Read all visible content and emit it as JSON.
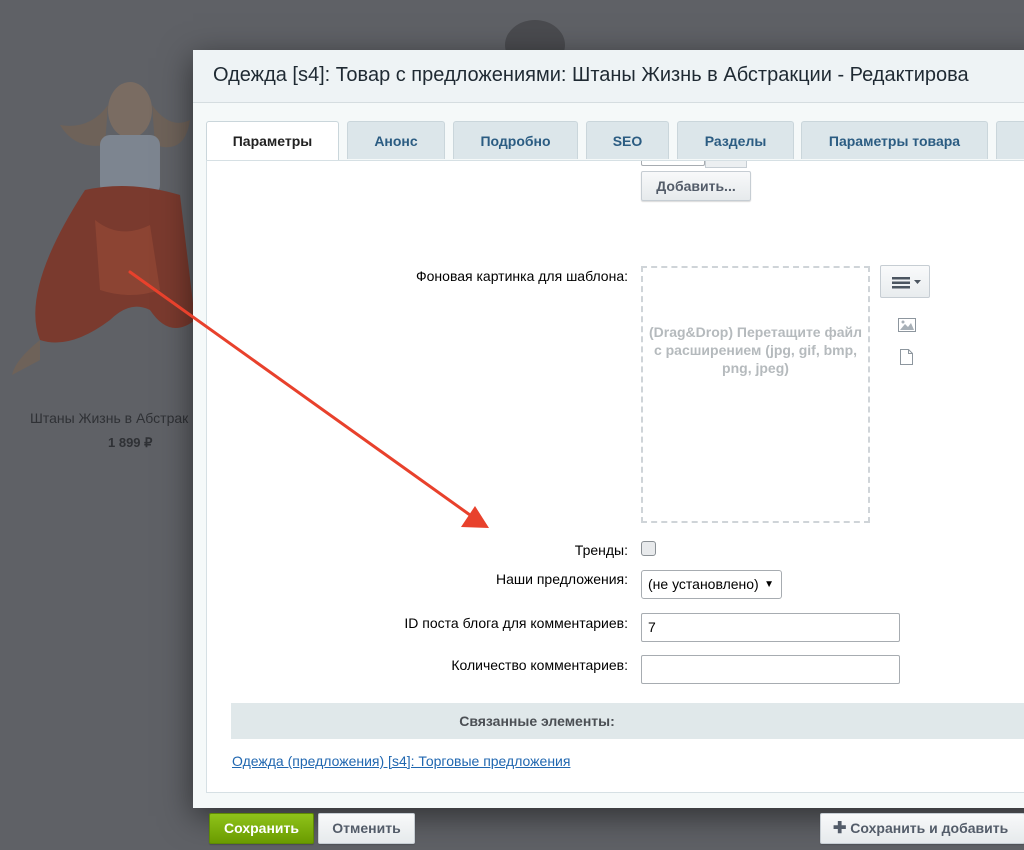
{
  "background": {
    "product_title": "Штаны Жизнь в Абстрак",
    "product_price": "1 899 ₽"
  },
  "dialog": {
    "title": "Одежда [s4]: Товар с предложениями: Штаны Жизнь в Абстракции - Редактирова"
  },
  "tabs": [
    {
      "label": "Параметры",
      "active": true
    },
    {
      "label": "Анонс"
    },
    {
      "label": "Подробно"
    },
    {
      "label": "SEO"
    },
    {
      "label": "Разделы"
    },
    {
      "label": "Параметры товара"
    }
  ],
  "form": {
    "add_button": "Добавить...",
    "bg_image_label": "Фоновая картинка для шаблона:",
    "dropzone_text": "(Drag&Drop) Перетащите файл с расширением (jpg, gif, bmp, png, jpeg)",
    "trends_label": "Тренды:",
    "offers_label": "Наши предложения:",
    "offers_value": "(не установлено)",
    "blog_post_label": "ID поста блога для комментариев:",
    "blog_post_value": "7",
    "comments_count_label": "Количество комментариев:",
    "comments_count_value": "",
    "related_section": "Связанные элементы:",
    "related_link": "Одежда (предложения) [s4]: Торговые предложения"
  },
  "footer": {
    "save": "Сохранить",
    "cancel": "Отменить",
    "save_add": "Сохранить и добавить",
    "save_add_icon": "plus-icon"
  },
  "colors": {
    "save_button": "#7bb10b",
    "link": "#2067b0",
    "annotation_arrow": "#e8412c"
  },
  "icons": [
    "menu-icon",
    "image-icon",
    "file-icon",
    "chevron-down-icon",
    "plus-icon"
  ]
}
